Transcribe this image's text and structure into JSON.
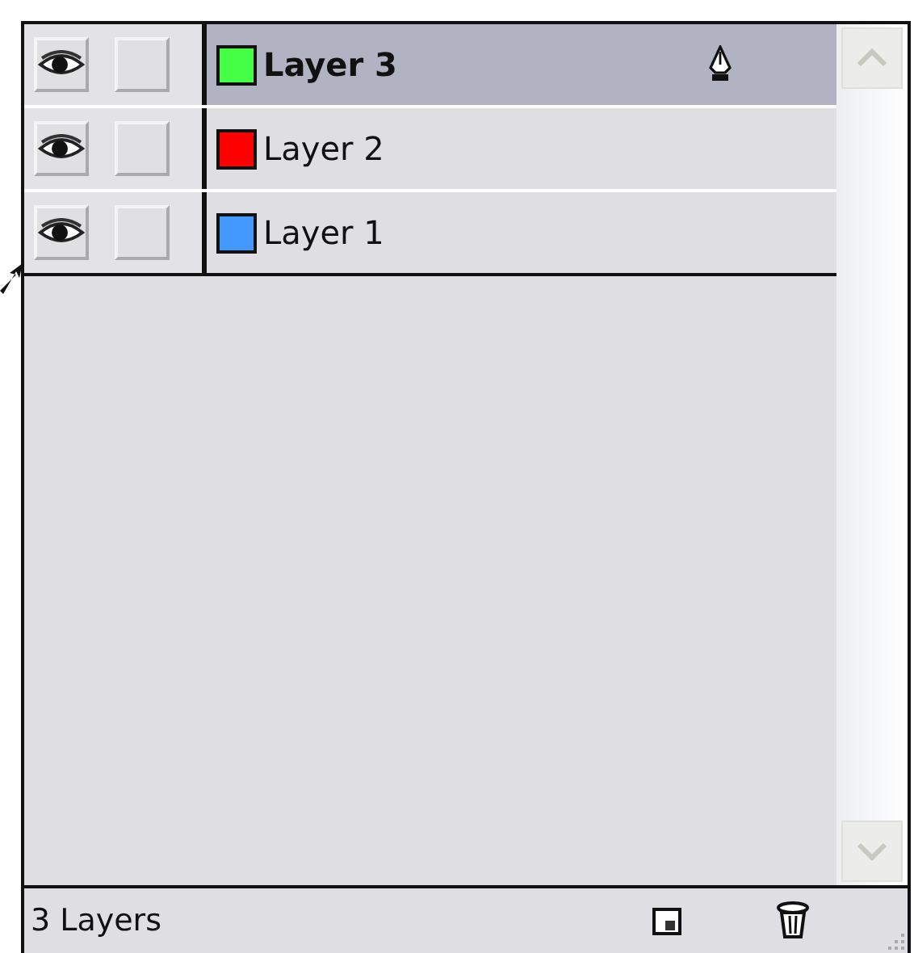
{
  "layers": [
    {
      "name": "Layer 3",
      "color": "#44ff44",
      "visible": true,
      "locked": false,
      "selected": true
    },
    {
      "name": "Layer 2",
      "color": "#ff0000",
      "visible": true,
      "locked": false,
      "selected": false
    },
    {
      "name": "Layer 1",
      "color": "#4499ff",
      "visible": true,
      "locked": false,
      "selected": false
    }
  ],
  "status_bar": {
    "text": "3 Layers"
  }
}
